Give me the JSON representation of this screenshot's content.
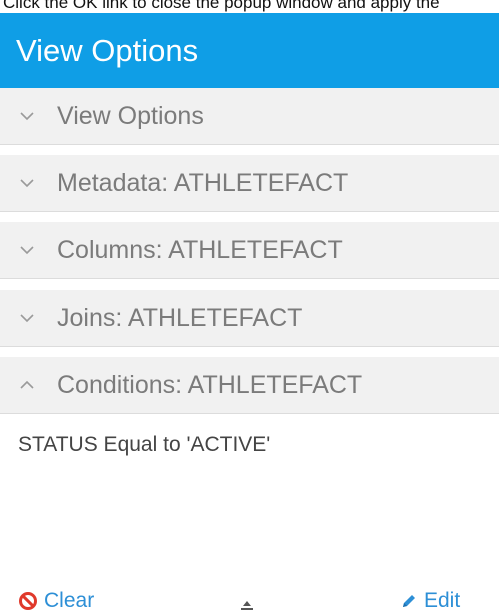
{
  "caption": "Click the OK link to close the popup window and apply the",
  "header": {
    "title": "View Options"
  },
  "sections": [
    {
      "label": "View Options",
      "state": "collapsed"
    },
    {
      "label": "Metadata: ATHLETEFACT",
      "state": "collapsed"
    },
    {
      "label": "Columns: ATHLETEFACT",
      "state": "collapsed"
    },
    {
      "label": "Joins: ATHLETEFACT",
      "state": "collapsed"
    },
    {
      "label": "Conditions: ATHLETEFACT",
      "state": "expanded"
    }
  ],
  "conditions": {
    "text": "STATUS Equal to 'ACTIVE'"
  },
  "footer": {
    "clear_label": "Clear",
    "edit_label": "Edit"
  },
  "colors": {
    "header_bg": "#0f9ee6",
    "link": "#2d8fd6",
    "clear_icon": "#e0392b"
  },
  "icons": {
    "collapsed": "chevron-down-icon",
    "expanded": "chevron-up-icon",
    "clear": "ban-icon",
    "edit": "pencil-icon",
    "middle": "collapse-bar-icon"
  }
}
